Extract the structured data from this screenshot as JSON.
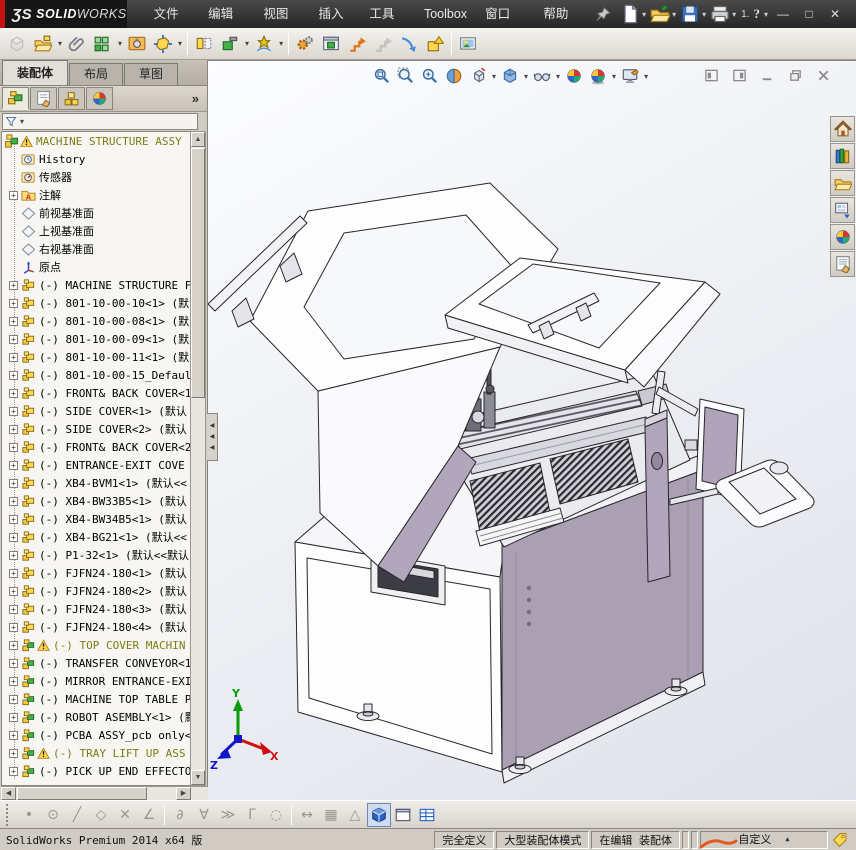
{
  "title_bar": {
    "logo_glyph": "ƷS",
    "logo_text_bold": "SOLID",
    "logo_text_light": "WORKS",
    "menus": [
      "文件(F)",
      "编辑(E)",
      "视图(V)",
      "插入(I)",
      "工具(T)",
      "Toolbox",
      "窗口(W)",
      "帮助(H)"
    ],
    "quick_icons": [
      {
        "icon": "new-doc",
        "caret": true
      },
      {
        "icon": "open-doc",
        "caret": true
      },
      {
        "icon": "save-doc",
        "caret": true
      },
      {
        "icon": "print-doc",
        "caret": true
      }
    ],
    "misc_label": "1.",
    "help_label": "?",
    "window_buttons": {
      "minimize": "—",
      "maximize": "□",
      "close": "✕"
    }
  },
  "assembly_toolbar": {
    "items": [
      {
        "icon": "edit-component",
        "disabled": true
      },
      {
        "icon": "insert-components",
        "caret": true
      },
      {
        "icon": "mate"
      },
      {
        "icon": "linear-component-pattern",
        "caret": true
      },
      {
        "icon": "smart-fasteners"
      },
      {
        "icon": "move-component",
        "caret": true
      },
      {
        "sep": true
      },
      {
        "icon": "show-hidden-components"
      },
      {
        "icon": "assembly-features",
        "caret": true
      },
      {
        "icon": "new-motion-study",
        "caret": true
      },
      {
        "sep": true
      },
      {
        "icon": "simulation-gears"
      },
      {
        "icon": "interference-detection"
      },
      {
        "icon": "exploded-view"
      },
      {
        "icon": "explode-line-sketch",
        "disabled": true
      },
      {
        "icon": "curve-arrow"
      },
      {
        "icon": "large-assembly-mode"
      },
      {
        "sep": true
      },
      {
        "icon": "render-image"
      }
    ]
  },
  "command_manager": {
    "tabs": [
      "装配体",
      "布局",
      "草图"
    ],
    "active_index": 0
  },
  "feature_tabs": {
    "icons": [
      "featuremanager-tree",
      "property-manager",
      "configuration-manager",
      "display-manager"
    ],
    "overflow": "»"
  },
  "filter": {
    "icon": "filter-funnel"
  },
  "tree": {
    "items": [
      {
        "icon": "asm-top",
        "warn": true,
        "root": true,
        "label": "MACHINE STRUCTURE ASSY"
      },
      {
        "icon": "history",
        "label": "History"
      },
      {
        "icon": "sensor",
        "label": "传感器"
      },
      {
        "icon": "annotation",
        "expand": true,
        "label": "注解"
      },
      {
        "icon": "plane",
        "label": "前视基准面"
      },
      {
        "icon": "plane",
        "label": "上视基准面"
      },
      {
        "icon": "plane",
        "label": "右视基准面"
      },
      {
        "icon": "origin",
        "label": "原点"
      },
      {
        "icon": "part",
        "expand": true,
        "label": "(-) MACHINE STRUCTURE F"
      },
      {
        "icon": "part",
        "expand": true,
        "label": "(-) 801-10-00-10<1> (默"
      },
      {
        "icon": "part",
        "expand": true,
        "label": "(-) 801-10-00-08<1> (默"
      },
      {
        "icon": "part",
        "expand": true,
        "label": "(-) 801-10-00-09<1> (默"
      },
      {
        "icon": "part",
        "expand": true,
        "label": "(-) 801-10-00-11<1> (默"
      },
      {
        "icon": "part",
        "expand": true,
        "label": "(-) 801-10-00-15_Defaul"
      },
      {
        "icon": "part",
        "expand": true,
        "label": "(-) FRONT& BACK COVER<1"
      },
      {
        "icon": "part",
        "expand": true,
        "label": "(-) SIDE COVER<1> (默认"
      },
      {
        "icon": "part",
        "expand": true,
        "label": "(-) SIDE COVER<2> (默认"
      },
      {
        "icon": "part",
        "expand": true,
        "label": "(-) FRONT& BACK COVER<2"
      },
      {
        "icon": "part",
        "expand": true,
        "label": "(-) ENTRANCE-EXIT  COVE"
      },
      {
        "icon": "part",
        "expand": true,
        "label": "(-) XB4-BVM1<1> (默认<<"
      },
      {
        "icon": "part",
        "expand": true,
        "label": "(-) XB4-BW33B5<1> (默认"
      },
      {
        "icon": "part",
        "expand": true,
        "label": "(-) XB4-BW34B5<1> (默认"
      },
      {
        "icon": "part",
        "expand": true,
        "label": "(-) XB4-BG21<1> (默认<<"
      },
      {
        "icon": "part",
        "expand": true,
        "label": "(-) P1-32<1> (默认<<默认"
      },
      {
        "icon": "part",
        "expand": true,
        "label": "(-) FJFN24-180<1> (默认"
      },
      {
        "icon": "part",
        "expand": true,
        "label": "(-) FJFN24-180<2> (默认"
      },
      {
        "icon": "part",
        "expand": true,
        "label": "(-) FJFN24-180<3> (默认"
      },
      {
        "icon": "part",
        "expand": true,
        "label": "(-) FJFN24-180<4> (默认"
      },
      {
        "icon": "asm",
        "expand": true,
        "warn": true,
        "label": "(-) TOP COVER MACHIN"
      },
      {
        "icon": "asm",
        "expand": true,
        "label": "(-) TRANSFER CONVEYOR<1"
      },
      {
        "icon": "asm",
        "expand": true,
        "label": "(-) MIRROR ENTRANCE-EXI"
      },
      {
        "icon": "asm",
        "expand": true,
        "label": "(-) MACHINE TOP TABLE P"
      },
      {
        "icon": "asm",
        "expand": true,
        "label": "(-) ROBOT ASEMBLY<1> (默"
      },
      {
        "icon": "asm",
        "expand": true,
        "label": "(-) PCBA ASSY_pcb only<"
      },
      {
        "icon": "asm",
        "expand": true,
        "warn": true,
        "label": "(-) TRAY LIFT UP ASS"
      },
      {
        "icon": "asm",
        "expand": true,
        "label": "(-) PICK UP END EFFECTO"
      }
    ]
  },
  "heads_up_toolbar": {
    "items": [
      {
        "icon": "zoom-to-fit"
      },
      {
        "icon": "zoom-to-area"
      },
      {
        "icon": "zoom-in-out"
      },
      {
        "icon": "section-view"
      },
      {
        "icon": "view-orientation",
        "caret": true
      },
      {
        "icon": "display-style",
        "caret": true
      },
      {
        "icon": "hide-show-items",
        "caret": true
      },
      {
        "icon": "edit-appearance"
      },
      {
        "icon": "apply-scene",
        "caret": true
      },
      {
        "icon": "view-settings",
        "caret": true
      }
    ]
  },
  "document_controls": {
    "icons": [
      "pane-left",
      "pane-right",
      "doc-minimize",
      "doc-restore",
      "doc-close"
    ]
  },
  "task_pane": {
    "icons": [
      "solidworks-resources-home",
      "design-library",
      "file-explorer",
      "view-palette",
      "appearances-scenes",
      "custom-properties"
    ]
  },
  "bottom_toolbar": {
    "items": [
      {
        "glyph": "•",
        "name": "sketch-point",
        "disabled": true
      },
      {
        "glyph": "⊙",
        "name": "sketch-circle",
        "disabled": true
      },
      {
        "glyph": "╱",
        "name": "sketch-line",
        "disabled": true
      },
      {
        "glyph": "◇",
        "name": "sketch-polygon",
        "disabled": true
      },
      {
        "glyph": "✕",
        "name": "sketch-trim",
        "disabled": true
      },
      {
        "glyph": "∠",
        "name": "sketch-fillet",
        "disabled": true
      },
      {
        "sep": true
      },
      {
        "glyph": "∂",
        "name": "sketch-spline",
        "disabled": true
      },
      {
        "glyph": "∀",
        "name": "sketch-mirror",
        "disabled": true
      },
      {
        "glyph": "≫",
        "name": "sketch-offset",
        "disabled": true
      },
      {
        "glyph": "Γ",
        "name": "sketch-corner",
        "disabled": true
      },
      {
        "glyph": "◌",
        "name": "sketch-points",
        "disabled": true
      },
      {
        "sep": true
      },
      {
        "glyph": "↔",
        "name": "smart-dimension",
        "disabled": true
      },
      {
        "glyph": "▦",
        "name": "grid-snap",
        "disabled": true
      },
      {
        "glyph": "△",
        "name": "sketch-triangle",
        "disabled": true
      },
      {
        "icon": "shaded-cube",
        "name": "shaded-with-edges",
        "active": true
      },
      {
        "icon": "viewport-single",
        "name": "single-viewport"
      },
      {
        "icon": "table-view",
        "name": "table-view"
      }
    ]
  },
  "status_bar": {
    "left_text": "SolidWorks Premium 2014 x64 版",
    "cells": [
      "完全定义",
      "大型装配体模式",
      "在编辑 装配体"
    ],
    "custom_label": "自定义"
  },
  "viewport": {
    "triad": {
      "x": "X",
      "y": "Y",
      "z": "Z"
    }
  }
}
